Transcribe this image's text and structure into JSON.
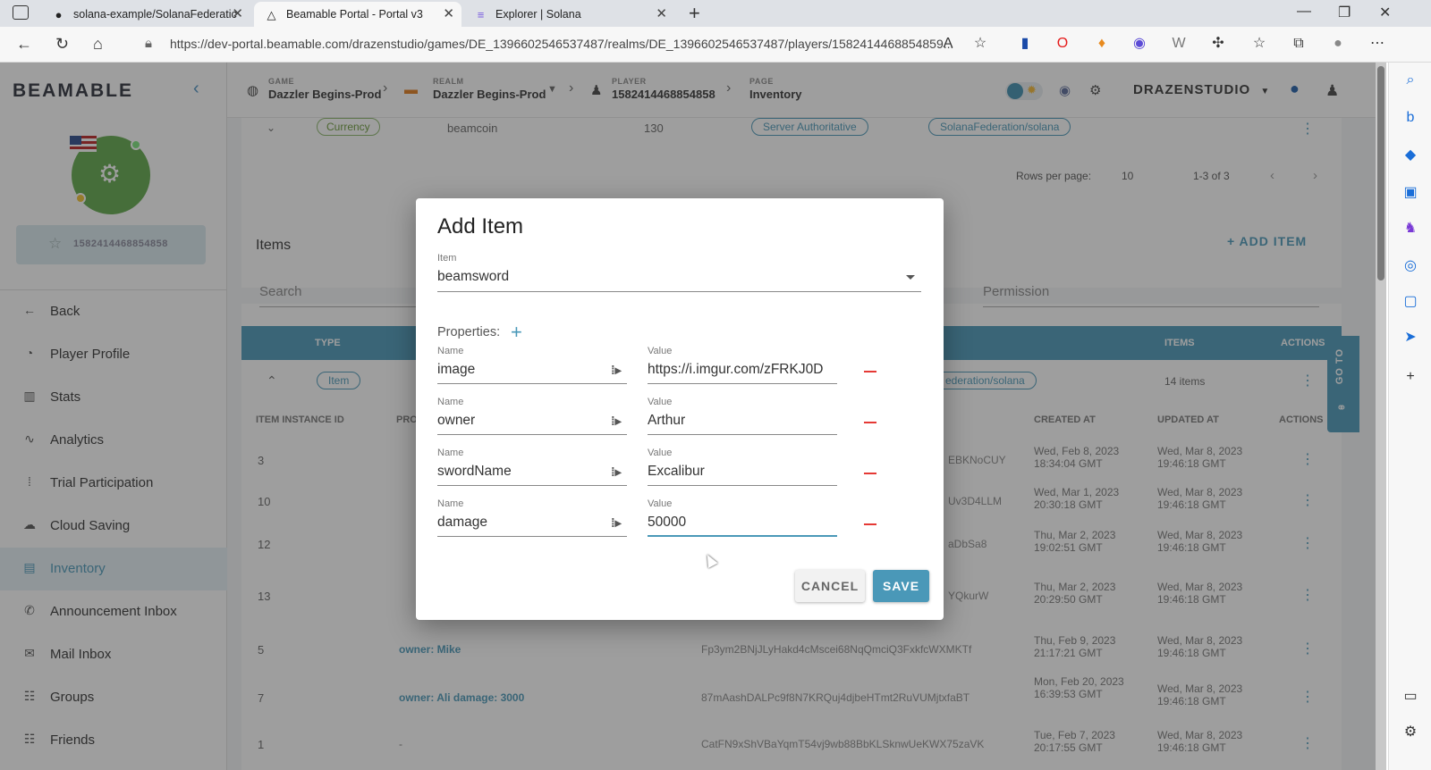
{
  "browser": {
    "tabs": [
      {
        "title": "solana-example/SolanaFederatic",
        "icon": "github-icon"
      },
      {
        "title": "Beamable Portal - Portal v3",
        "icon": "beamable-icon"
      },
      {
        "title": "Explorer | Solana",
        "icon": "solana-icon"
      }
    ],
    "url": "https://dev-portal.beamable.com/drazenstudio/games/DE_1396602546537487/realms/DE_1396602546537487/players/1582414468854859..."
  },
  "sidebar": {
    "logo": "BEAMABLE",
    "player_id": "1582414468854858",
    "items": [
      {
        "label": "Back",
        "icon": "←"
      },
      {
        "label": "Player Profile",
        "icon": "◔"
      },
      {
        "label": "Stats",
        "icon": "▥"
      },
      {
        "label": "Analytics",
        "icon": "∿"
      },
      {
        "label": "Trial Participation",
        "icon": "⁞"
      },
      {
        "label": "Cloud Saving",
        "icon": "☁"
      },
      {
        "label": "Inventory",
        "icon": "▤"
      },
      {
        "label": "Announcement Inbox",
        "icon": "✆"
      },
      {
        "label": "Mail Inbox",
        "icon": "✉"
      },
      {
        "label": "Groups",
        "icon": "☷"
      },
      {
        "label": "Friends",
        "icon": "☷"
      }
    ]
  },
  "topbar": {
    "game_label": "GAME",
    "game_value": "Dazzler Begins-Prod",
    "realm_label": "REALM",
    "realm_value": "Dazzler Begins-Prod",
    "player_label": "PLAYER",
    "player_value": "1582414468854858",
    "page_label": "PAGE",
    "page_value": "Inventory",
    "studio": "DRAZENSTUDIO"
  },
  "background": {
    "currency_chip": "Currency",
    "currency_name": "beamcoin",
    "currency_amount": "130",
    "server_chip": "Server Authoritative",
    "federation_chip": "SolanaFederation/solana",
    "rows_per_page_label": "Rows per page:",
    "rows_per_page": "10",
    "pagination": "1-3 of 3",
    "items_title": "Items",
    "add_item": "ADD ITEM",
    "search_placeholder": "Search",
    "permission_placeholder": "Permission",
    "col_type": "TYPE",
    "col_items": "ITEMS",
    "col_actions": "ACTIONS",
    "item_chip": "Item",
    "federation_chip2": "ederation/solana",
    "items_count": "14 items",
    "go_to": "GO TO",
    "sub_cols": [
      "ITEM INSTANCE ID",
      "PRO",
      "CREATED AT",
      "UPDATED AT",
      "ACTIONS"
    ],
    "rows": [
      {
        "id": "3",
        "props": "",
        "proxy": "EBKNoCUY",
        "created": "Wed, Feb 8, 2023 18:34:04 GMT",
        "updated": "Wed, Mar 8, 2023 19:46:18 GMT"
      },
      {
        "id": "10",
        "props": "",
        "proxy": "Uv3D4LLM",
        "created": "Wed, Mar 1, 2023 20:30:18 GMT",
        "updated": "Wed, Mar 8, 2023 19:46:18 GMT"
      },
      {
        "id": "12",
        "props": "",
        "proxy": "aDbSa8",
        "created": "Thu, Mar 2, 2023 19:02:51 GMT",
        "updated": "Wed, Mar 8, 2023 19:46:18 GMT"
      },
      {
        "id": "13",
        "props": "",
        "proxy": "YQkurW",
        "created": "Thu, Mar 2, 2023 20:29:50 GMT",
        "updated": "Wed, Mar 8, 2023 19:46:18 GMT"
      },
      {
        "id": "5",
        "props": "owner: Mike",
        "proxy": "Fp3ym2BNjJLyHakd4cMscei68NqQmciQ3FxkfcWXMKTf",
        "created": "Thu, Feb 9, 2023 21:17:21 GMT",
        "updated": "Wed, Mar 8, 2023 19:46:18 GMT"
      },
      {
        "id": "7",
        "props": "owner: Ali   damage: 3000",
        "proxy": "87mAashDALPc9f8N7KRQuj4djbeHTmt2RuVUMjtxfaBT",
        "created": "Mon, Feb 20, 2023 16:39:53 GMT",
        "updated": "Wed, Mar 8, 2023 19:46:18 GMT"
      },
      {
        "id": "1",
        "props": "-",
        "proxy": "CatFN9xShVBaYqmT54vj9wb88BbKLSknwUeKWX75zaVK",
        "created": "Tue, Feb 7, 2023 20:17:55 GMT",
        "updated": "Wed, Mar 8, 2023 19:46:18 GMT"
      }
    ]
  },
  "dialog": {
    "title": "Add Item",
    "item_label": "Item",
    "item_value": "beamsword",
    "properties_label": "Properties:",
    "name_label": "Name",
    "value_label": "Value",
    "properties": [
      {
        "name": "image",
        "value": "https://i.imgur.com/zFRKJ0D"
      },
      {
        "name": "owner",
        "value": "Arthur"
      },
      {
        "name": "swordName",
        "value": "Excalibur"
      },
      {
        "name": "damage",
        "value": "50000"
      }
    ],
    "cancel": "CANCEL",
    "save": "SAVE"
  },
  "colors": {
    "accent": "#4a98b8",
    "remove": "#e53935",
    "avatar": "#5fa84a"
  }
}
